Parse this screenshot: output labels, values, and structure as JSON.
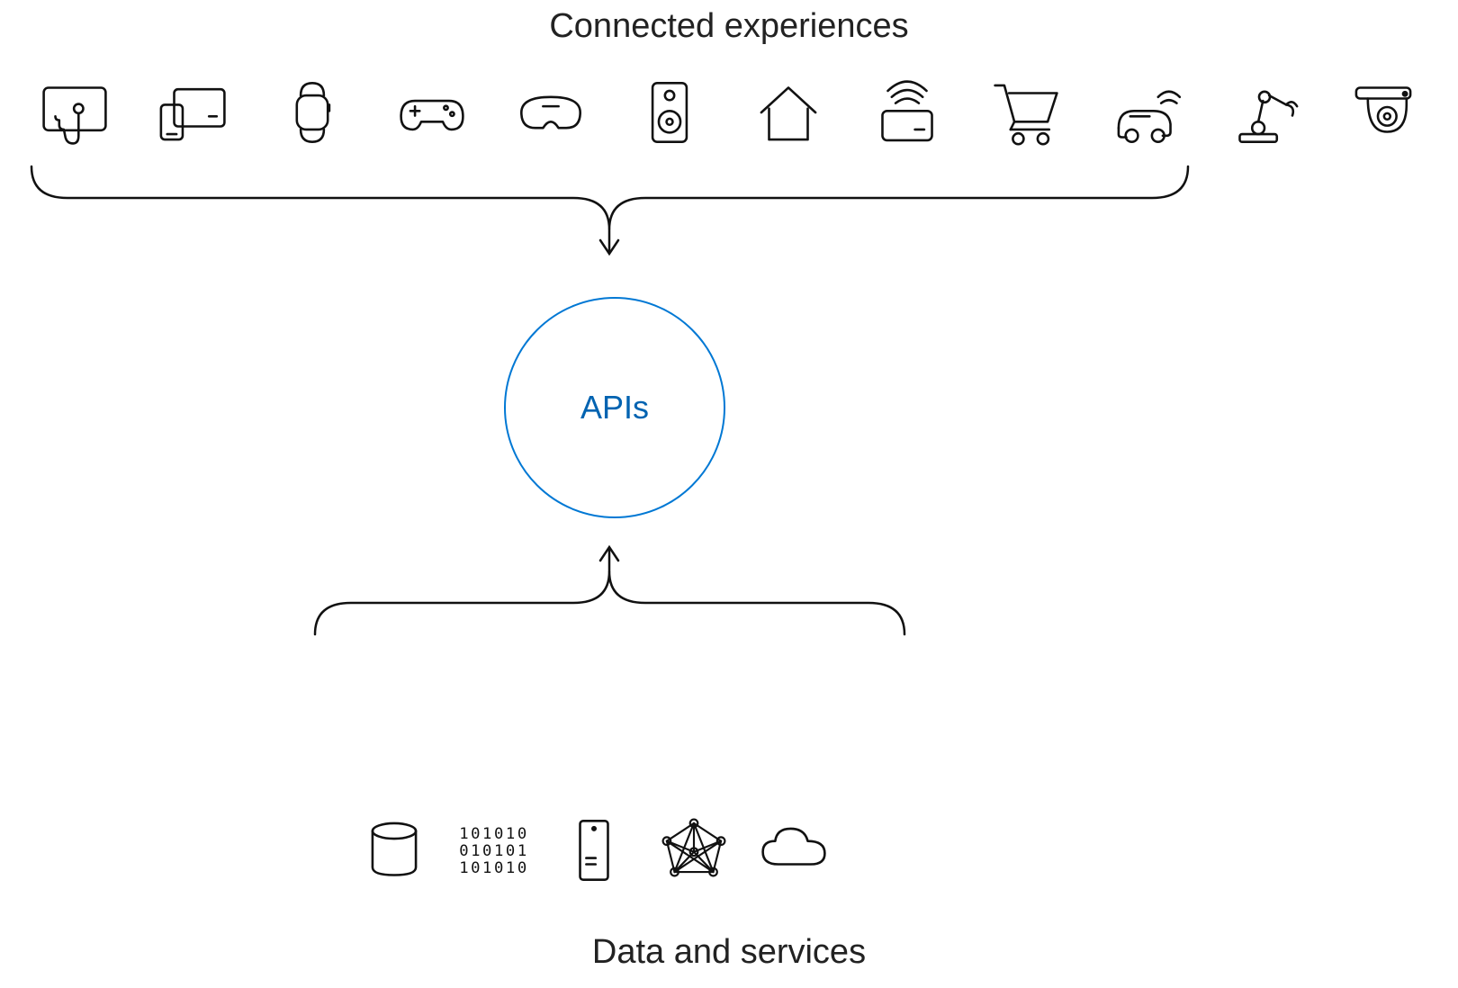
{
  "top_title": "Connected experiences",
  "bottom_title": "Data and services",
  "center_label": "APIs",
  "accent_color": "#0078D4",
  "icons_top": [
    "touch-device-icon",
    "multi-device-icon",
    "smartwatch-icon",
    "game-controller-icon",
    "vr-headset-icon",
    "speaker-icon",
    "home-icon",
    "contactless-pay-icon",
    "shopping-cart-icon",
    "connected-car-icon",
    "robot-arm-icon",
    "security-camera-icon"
  ],
  "icons_bottom": [
    "database-icon",
    "binary-data-icon",
    "server-icon",
    "network-graph-icon",
    "cloud-icon"
  ]
}
